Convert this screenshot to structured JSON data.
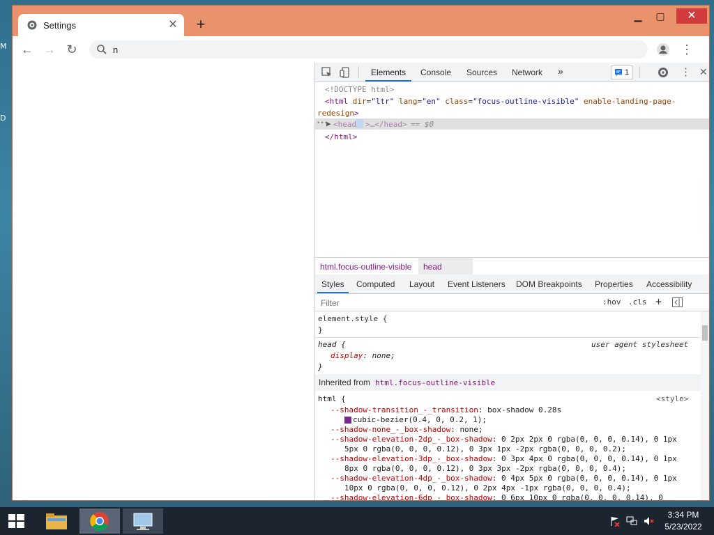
{
  "desktop": {
    "edge_letters": [
      "M",
      "D"
    ]
  },
  "browser": {
    "tab_title": "Settings",
    "new_tab_symbol": "+",
    "address_text": "n",
    "accent_color": "#e9926b"
  },
  "devtools": {
    "tabs": [
      "Elements",
      "Console",
      "Sources",
      "Network"
    ],
    "more_tabs": "»",
    "issues_count": "1",
    "dom": {
      "doctype": "<!DOCTYPE html>",
      "html_open_tag": "html",
      "attr_dir_name": "dir",
      "attr_dir_val": "\"ltr\"",
      "attr_lang_name": "lang",
      "attr_lang_val": "\"en\"",
      "attr_class_name": "class",
      "attr_class_val": "\"focus-outline-visible\"",
      "attr_extra": "enable-landing-page-",
      "attr_extra_cont": "redesign",
      "head_line_tag": "<head",
      "head_line_rest": ">…</head>",
      "head_line_eq": "== $0",
      "html_close": "</html>",
      "dots": "•••"
    },
    "breadcrumbs": [
      "html.focus-outline-visible",
      "head"
    ],
    "subtabs": [
      "Styles",
      "Computed",
      "Layout",
      "Event Listeners",
      "DOM Breakpoints",
      "Properties",
      "Accessibility"
    ],
    "filter_placeholder": "Filter",
    "hov": ":hov",
    "cls": ".cls",
    "styles": {
      "element_style_open": "element.style {",
      "close_brace": "}",
      "head_rule_open": "head {",
      "head_rule_source": "user agent stylesheet",
      "display_prop": "display",
      "display_val": "none;",
      "inherited_label": "Inherited from",
      "inherited_link": "html.focus-outline-visible",
      "html_rule_open": "html {",
      "html_rule_source": "<style>",
      "lines": [
        {
          "prop": "--shadow-transition_-_transition",
          "val": "box-shadow 0.28s"
        },
        {
          "prop": "",
          "val": "cubic-bezier(0.4, 0, 0.2, 1);"
        },
        {
          "prop": "--shadow-none_-_box-shadow",
          "val": "none;"
        },
        {
          "prop": "--shadow-elevation-2dp_-_box-shadow",
          "val": "0 2px 2px 0 rgba(0, 0, 0, 0.14), 0 1px"
        },
        {
          "prop": "",
          "val": "5px 0 rgba(0, 0, 0, 0.12), 0 3px 1px -2px rgba(0, 0, 0, 0.2);"
        },
        {
          "prop": "--shadow-elevation-3dp_-_box-shadow",
          "val": "0 3px 4px 0 rgba(0, 0, 0, 0.14), 0 1px"
        },
        {
          "prop": "",
          "val": "8px 0 rgba(0, 0, 0, 0.12), 0 3px 3px -2px rgba(0, 0, 0, 0.4);"
        },
        {
          "prop": "--shadow-elevation-4dp_-_box-shadow",
          "val": "0 4px 5px 0 rgba(0, 0, 0, 0.14), 0 1px"
        },
        {
          "prop": "",
          "val": "10px 0 rgba(0, 0, 0, 0.12), 0 2px 4px -1px rgba(0, 0, 0, 0.4);"
        },
        {
          "prop": "--shadow-elevation-6dp_-_box-shadow",
          "val": "0 6px 10px 0 rgba(0, 0, 0, 0.14), 0"
        }
      ]
    }
  },
  "taskbar": {
    "time": "3:34 PM",
    "date": "5/23/2022"
  }
}
